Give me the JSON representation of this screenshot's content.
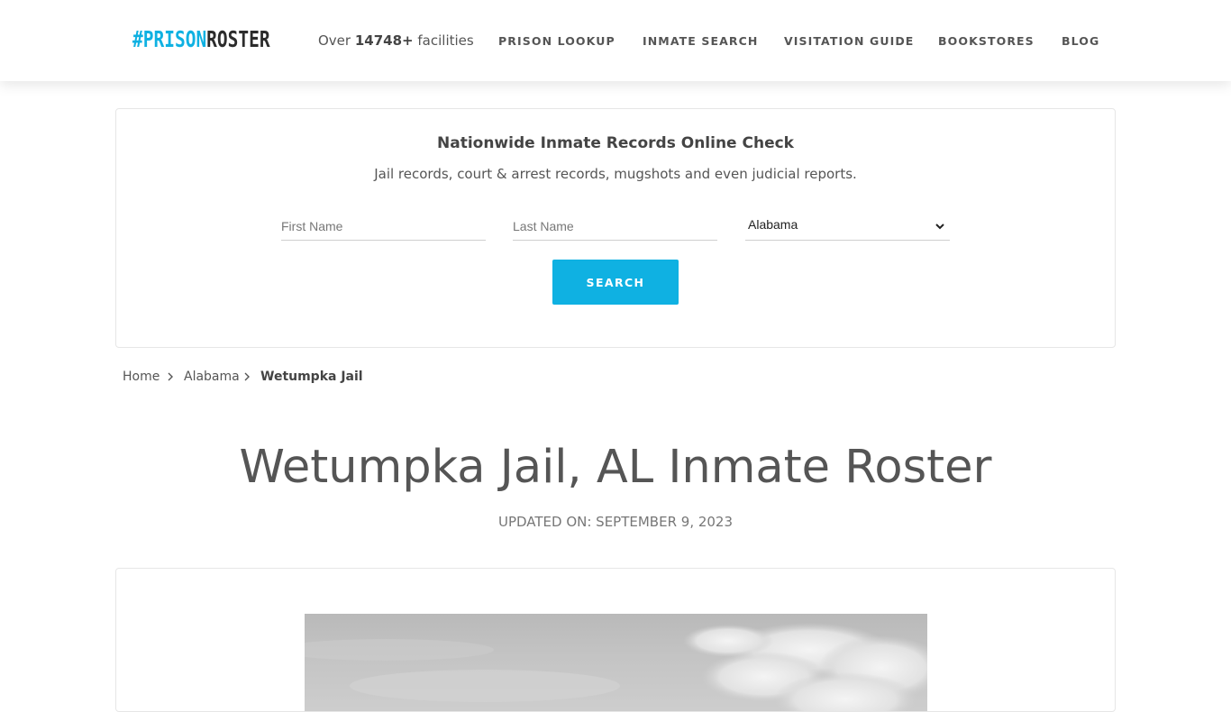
{
  "header": {
    "logo": {
      "part1": "#PRISON",
      "part2": "ROSTER"
    },
    "facility_count": {
      "prefix": "Over ",
      "count": "14748+",
      "suffix": " facilities"
    },
    "nav": [
      {
        "label": "PRISON LOOKUP"
      },
      {
        "label": "INMATE SEARCH"
      },
      {
        "label": "VISITATION GUIDE"
      },
      {
        "label": "BOOKSTORES"
      },
      {
        "label": "BLOG"
      }
    ]
  },
  "search": {
    "title": "Nationwide Inmate Records Online Check",
    "subtitle": "Jail records, court & arrest records, mugshots and even judicial reports.",
    "first_name_placeholder": "First Name",
    "last_name_placeholder": "Last Name",
    "state_selected": "Alabama",
    "button_label": "SEARCH"
  },
  "breadcrumb": [
    {
      "label": "Home"
    },
    {
      "label": "Alabama"
    },
    {
      "label": "Wetumpka Jail"
    }
  ],
  "page": {
    "title": "Wetumpka Jail, AL Inmate Roster",
    "updated": "UPDATED ON: SEPTEMBER 9, 2023"
  },
  "colors": {
    "accent": "#0fb1e2",
    "text": "#555555",
    "logo_dark": "#2c2c2c"
  },
  "icons": [
    "chevron-down-icon",
    "chevron-right-icon"
  ]
}
